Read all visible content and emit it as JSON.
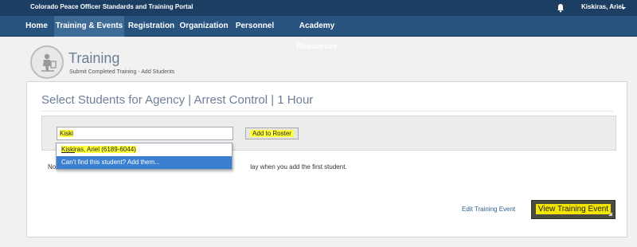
{
  "topbar": {
    "portal_title": "Colorado Peace Officer Standards and Training Portal",
    "user_name": "Kiskiras, Ariel",
    "icons": [
      "bell-icon",
      "caret-down-icon"
    ]
  },
  "nav": {
    "items": [
      "Home",
      "Training & Events",
      "Registration",
      "Organization",
      "Personnel",
      "Academy Resources"
    ],
    "active": "Training & Events"
  },
  "header": {
    "title": "Training",
    "subtitle": "Submit Completed Training - Add Students",
    "logo_icon": "training-figure-icon"
  },
  "panel": {
    "heading": "Select Students for Agency | Arrest Control | 1 Hour",
    "search": {
      "value": "Kiski",
      "add_label": "Add to Roster"
    },
    "autocomplete": {
      "match_prefix": "Kiski",
      "match_rest": "ras, Ariel (6189-6044)",
      "add_new": "Can't find this student? Add them..."
    },
    "note_left": "No",
    "note_right": "lay when you add the first student.",
    "edit_link": "Edit Training Event",
    "view_button": "View Training Event"
  },
  "colors": {
    "topbar": "#1c3e63",
    "nav": "#28537f",
    "highlight": "#ffff3a",
    "selection": "#3b7fd0",
    "accent_title": "#6d7f96"
  }
}
